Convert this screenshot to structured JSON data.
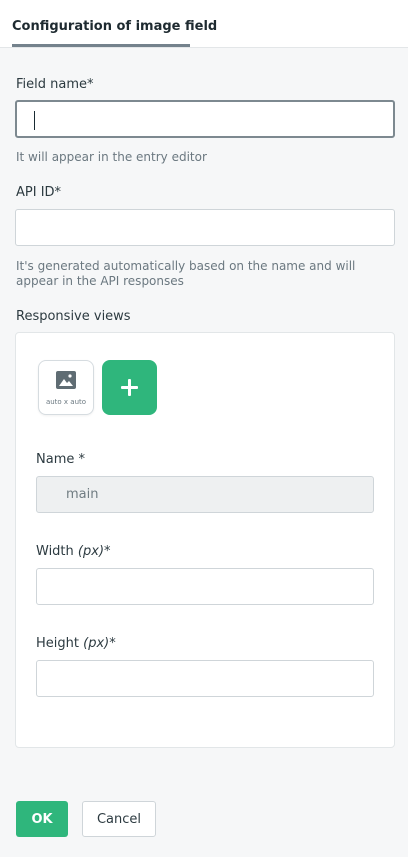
{
  "header": {
    "tab_label": "Configuration of image field"
  },
  "form": {
    "field_name": {
      "label": "Field name*",
      "value": "",
      "hint": "It will appear in the entry editor"
    },
    "api_id": {
      "label": "API ID*",
      "value": "",
      "hint": "It's generated automatically based on the name and will appear in the API responses"
    },
    "responsive_views": {
      "label": "Responsive views",
      "thumbnail_label": "auto x auto",
      "add_icon": "plus-icon",
      "thumbnail_icon": "image-icon",
      "name": {
        "label": "Name *",
        "value": "main"
      },
      "width": {
        "label": "Width",
        "unit": "(px)",
        "required": "*",
        "value": ""
      },
      "height": {
        "label": "Height",
        "unit": "(px)",
        "required": "*",
        "value": ""
      }
    }
  },
  "actions": {
    "ok_label": "OK",
    "cancel_label": "Cancel"
  },
  "colors": {
    "accent_green": "#2fb67c",
    "tab_underline": "#74828c",
    "background": "#f6f7f8"
  }
}
